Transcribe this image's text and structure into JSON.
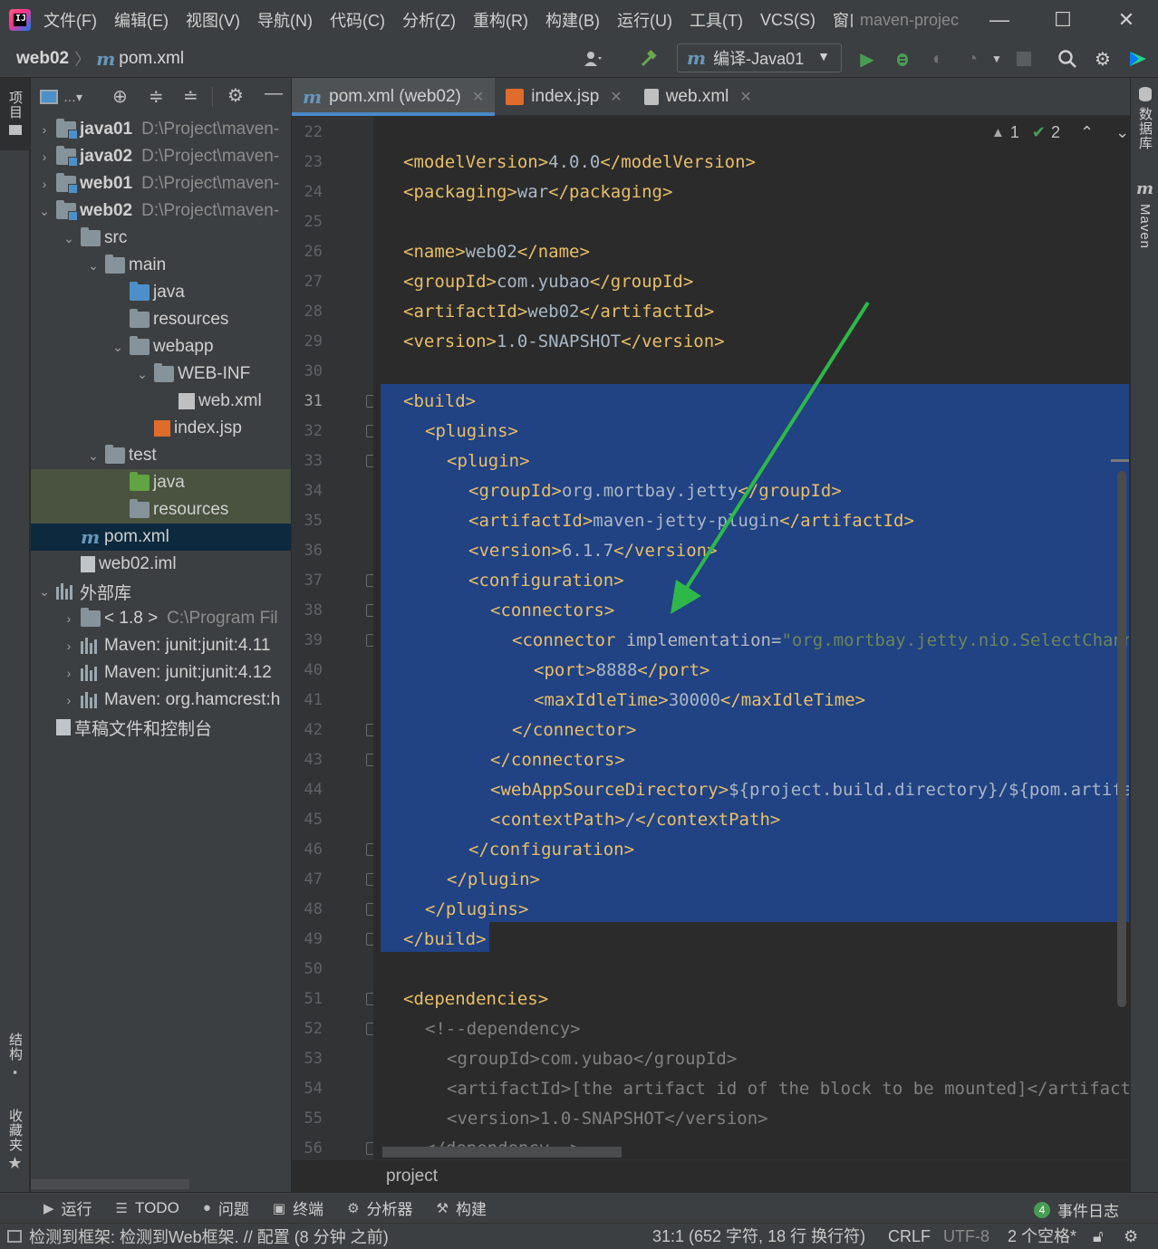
{
  "menubar": {
    "items": [
      "文件(F)",
      "编辑(E)",
      "视图(V)",
      "导航(N)",
      "代码(C)",
      "分析(Z)",
      "重构(R)",
      "构建(B)",
      "运行(U)",
      "工具(T)",
      "VCS(S)",
      "窗口"
    ],
    "project_name": "maven-projec",
    "minimize": "—",
    "maximize": "☐",
    "close": "✕"
  },
  "navbar": {
    "project": "web02",
    "separator": "〉",
    "file_icon": "m",
    "file": "pom.xml",
    "run_config": "编译-Java01",
    "run_config_icon": "m"
  },
  "left_strip": {
    "project_tab": "项目",
    "structure_tab": "结构",
    "favorites_tab": "收藏夹"
  },
  "right_strip": {
    "database_tab": "数据库",
    "maven_tab": "Maven",
    "maven_icon": "m"
  },
  "project_tree": [
    {
      "label": "java01",
      "path": "D:\\Project\\maven-",
      "bold": true,
      "arrow": "›",
      "icon": "module",
      "indent": 0
    },
    {
      "label": "java02",
      "path": "D:\\Project\\maven-",
      "bold": true,
      "arrow": "›",
      "icon": "module",
      "indent": 0
    },
    {
      "label": "web01",
      "path": "D:\\Project\\maven-",
      "bold": true,
      "arrow": "›",
      "icon": "module",
      "indent": 0
    },
    {
      "label": "web02",
      "path": "D:\\Project\\maven-",
      "bold": true,
      "arrow": "⌄",
      "icon": "module",
      "indent": 0
    },
    {
      "label": "src",
      "path": "",
      "arrow": "⌄",
      "icon": "folder",
      "indent": 1
    },
    {
      "label": "main",
      "path": "",
      "arrow": "⌄",
      "icon": "folder",
      "indent": 2
    },
    {
      "label": "java",
      "path": "",
      "arrow": "",
      "icon": "folder-blue",
      "indent": 3
    },
    {
      "label": "resources",
      "path": "",
      "arrow": "",
      "icon": "folder-res",
      "indent": 3
    },
    {
      "label": "webapp",
      "path": "",
      "arrow": "⌄",
      "icon": "folder-web",
      "indent": 3
    },
    {
      "label": "WEB-INF",
      "path": "",
      "arrow": "⌄",
      "icon": "folder",
      "indent": 4
    },
    {
      "label": "web.xml",
      "path": "",
      "arrow": "",
      "icon": "xml",
      "indent": 5
    },
    {
      "label": "index.jsp",
      "path": "",
      "arrow": "",
      "icon": "jsp",
      "indent": 4
    },
    {
      "label": "test",
      "path": "",
      "arrow": "⌄",
      "icon": "folder",
      "indent": 2
    },
    {
      "label": "java",
      "path": "",
      "arrow": "",
      "icon": "folder-green",
      "indent": 3
    },
    {
      "label": "resources",
      "path": "",
      "arrow": "",
      "icon": "folder-res",
      "indent": 3
    },
    {
      "label": "pom.xml",
      "path": "",
      "arrow": "",
      "icon": "maven",
      "indent": 1
    },
    {
      "label": "web02.iml",
      "path": "",
      "arrow": "",
      "icon": "file",
      "indent": 1
    },
    {
      "label": "外部库",
      "path": "",
      "arrow": "⌄",
      "icon": "lib",
      "indent": 0
    },
    {
      "label": "< 1.8 >",
      "path": "C:\\Program Fil",
      "arrow": "›",
      "icon": "jdk",
      "indent": 1
    },
    {
      "label": "Maven: junit:junit:4.11",
      "path": "",
      "arrow": "›",
      "icon": "lib",
      "indent": 1
    },
    {
      "label": "Maven: junit:junit:4.12",
      "path": "",
      "arrow": "›",
      "icon": "lib",
      "indent": 1
    },
    {
      "label": "Maven: org.hamcrest:h",
      "path": "",
      "arrow": "›",
      "icon": "lib",
      "indent": 1
    },
    {
      "label": "草稿文件和控制台",
      "path": "",
      "arrow": "",
      "icon": "scratch",
      "indent": 0
    }
  ],
  "editor_tabs": [
    {
      "label": "pom.xml (web02)",
      "icon": "m",
      "active": true,
      "close": "✕"
    },
    {
      "label": "index.jsp",
      "icon": "jsp",
      "active": false,
      "close": "✕"
    },
    {
      "label": "web.xml",
      "icon": "xml",
      "active": false,
      "close": "✕"
    }
  ],
  "inspections": {
    "warnings": "1",
    "ok": "2",
    "warn_icon": "▲",
    "ok_icon": "✔",
    "up": "⌃",
    "down": "⌄"
  },
  "code": {
    "line_numbers": [
      "22",
      "23",
      "24",
      "25",
      "26",
      "27",
      "28",
      "29",
      "30",
      "31",
      "32",
      "33",
      "34",
      "35",
      "36",
      "37",
      "38",
      "39",
      "40",
      "41",
      "42",
      "43",
      "44",
      "45",
      "46",
      "47",
      "48",
      "49",
      "50",
      "51",
      "52",
      "53",
      "54",
      "55",
      "56"
    ],
    "lines": [
      [],
      [
        [
          "tag",
          "<modelVersion>"
        ],
        [
          "txt",
          "4.0.0"
        ],
        [
          "tag",
          "</modelVersion>"
        ]
      ],
      [
        [
          "tag",
          "<packaging>"
        ],
        [
          "txt",
          "war"
        ],
        [
          "tag",
          "</packaging>"
        ]
      ],
      [],
      [
        [
          "tag",
          "<name>"
        ],
        [
          "txt",
          "web02"
        ],
        [
          "tag",
          "</name>"
        ]
      ],
      [
        [
          "tag",
          "<groupId>"
        ],
        [
          "txt",
          "com.yubao"
        ],
        [
          "tag",
          "</groupId>"
        ]
      ],
      [
        [
          "tag",
          "<artifactId>"
        ],
        [
          "txt",
          "web02"
        ],
        [
          "tag",
          "</artifactId>"
        ]
      ],
      [
        [
          "tag",
          "<version>"
        ],
        [
          "txt",
          "1.0-SNAPSHOT"
        ],
        [
          "tag",
          "</version>"
        ]
      ],
      [],
      [
        [
          "tag",
          "<build>"
        ]
      ],
      [
        [
          "tag",
          "<plugins>"
        ]
      ],
      [
        [
          "tag",
          "<plugin>"
        ]
      ],
      [
        [
          "tag",
          "<groupId>"
        ],
        [
          "txt",
          "org.mortbay.jetty"
        ],
        [
          "tag",
          "</groupId>"
        ]
      ],
      [
        [
          "tag",
          "<artifactId>"
        ],
        [
          "txt",
          "maven-jetty-plugin"
        ],
        [
          "tag",
          "</artifactId>"
        ]
      ],
      [
        [
          "tag",
          "<version>"
        ],
        [
          "txt",
          "6.1.7"
        ],
        [
          "tag",
          "</version>"
        ]
      ],
      [
        [
          "tag",
          "<configuration>"
        ]
      ],
      [
        [
          "tag",
          "<connectors>"
        ]
      ],
      [
        [
          "tag",
          "<connector "
        ],
        [
          "attr",
          "implementation"
        ],
        [
          "txt",
          "="
        ],
        [
          "aval",
          "\"org.mortbay.jetty.nio.SelectChannelConnector\""
        ],
        [
          "tag",
          ">"
        ]
      ],
      [
        [
          "tag",
          "<port>"
        ],
        [
          "txt",
          "8888"
        ],
        [
          "tag",
          "</port>"
        ]
      ],
      [
        [
          "tag",
          "<maxIdleTime>"
        ],
        [
          "txt",
          "30000"
        ],
        [
          "tag",
          "</maxIdleTime>"
        ]
      ],
      [
        [
          "tag",
          "</connector>"
        ]
      ],
      [
        [
          "tag",
          "</connectors>"
        ]
      ],
      [
        [
          "tag",
          "<webAppSourceDirectory>"
        ],
        [
          "txt",
          "${project.build.directory}/${pom.artifactId}"
        ],
        [
          "tag",
          "</webAppSourceDirectory>"
        ]
      ],
      [
        [
          "tag",
          "<contextPath>"
        ],
        [
          "txt",
          "/"
        ],
        [
          "tag",
          "</contextPath>"
        ]
      ],
      [
        [
          "tag",
          "</configuration>"
        ]
      ],
      [
        [
          "tag",
          "</plugin>"
        ]
      ],
      [
        [
          "tag",
          "</plugins>"
        ]
      ],
      [
        [
          "tag",
          "</build>"
        ]
      ],
      [],
      [
        [
          "tag",
          "<dependencies>"
        ]
      ],
      [
        [
          "cmt",
          "<!--dependency>"
        ]
      ],
      [
        [
          "cmt",
          "<groupId>com.yubao</groupId>"
        ]
      ],
      [
        [
          "cmt",
          "<artifactId>[the artifact id of the block to be mounted]</artifactId>"
        ]
      ],
      [
        [
          "cmt",
          "<version>1.0-SNAPSHOT</version>"
        ]
      ],
      [
        [
          "cmt",
          "</dependency-->"
        ]
      ]
    ],
    "indents": [
      0,
      1,
      1,
      0,
      1,
      1,
      1,
      1,
      0,
      1,
      2,
      3,
      4,
      4,
      4,
      4,
      5,
      6,
      7,
      7,
      6,
      5,
      5,
      5,
      4,
      3,
      2,
      1,
      0,
      1,
      2,
      3,
      3,
      3,
      2
    ]
  },
  "editor_breadcrumb": "project",
  "bottom_tools": [
    {
      "icon": "▶",
      "label": "运行"
    },
    {
      "icon": "☰",
      "label": "TODO"
    },
    {
      "icon": "●",
      "label": "问题"
    },
    {
      "icon": "▣",
      "label": "终端"
    },
    {
      "icon": "⚙",
      "label": "分析器"
    },
    {
      "icon": "⚒",
      "label": "构建"
    }
  ],
  "event_log": {
    "count": "4",
    "label": "事件日志"
  },
  "statusbar": {
    "message": "检测到框架: 检测到Web框架. // 配置 (8 分钟 之前)",
    "position": "31:1 (652 字符, 18 行 换行符)",
    "line_sep": "CRLF",
    "encoding": "UTF-8",
    "indent": "2 个空格*"
  },
  "colors": {
    "selection": "#214283",
    "tag": "#e8bf6a",
    "text": "#a9b7c6",
    "arrow": "#2eb84a"
  }
}
